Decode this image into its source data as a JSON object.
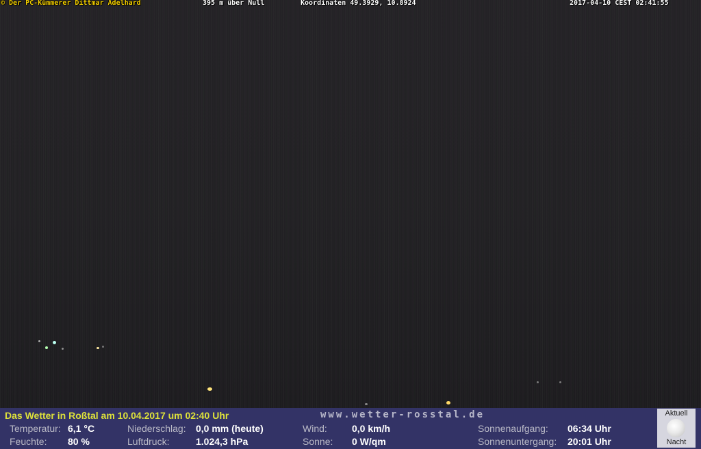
{
  "overlay": {
    "copyright": "© Der PC-Kümmerer Dittmar Adelhard",
    "elevation": "395 m über Null",
    "coordinates": "Koordinaten 49.3929, 10.8924",
    "timestamp": "2017-04-10 CEST 02:41:55"
  },
  "weather": {
    "headline": "Das Wetter in Roßtal am 10.04.2017 um 02:40 Uhr",
    "website": "www.wetter-rosstal.de",
    "temperature_label": "Temperatur:",
    "temperature_value": "6,1 °C",
    "humidity_label": "Feuchte:",
    "humidity_value": "80 %",
    "precipitation_label": "Niederschlag:",
    "precipitation_value": "0,0 mm (heute)",
    "pressure_label": "Luftdruck:",
    "pressure_value": "1.024,3 hPa",
    "wind_label": "Wind:",
    "wind_value": "0,0 km/h",
    "sun_label": "Sonne:",
    "sun_value": "0 W/qm",
    "sunrise_label": "Sonnenaufgang:",
    "sunrise_value": "06:34 Uhr",
    "sunset_label": "Sonnenuntergang:",
    "sunset_value": "20:01 Uhr"
  },
  "moon": {
    "top_label": "Aktuell",
    "bottom_label": "Nacht",
    "icon": "moon-icon"
  },
  "colors": {
    "panel_background": "#333366",
    "headline": "#dde13a",
    "copyright_text": "#f5d000"
  }
}
